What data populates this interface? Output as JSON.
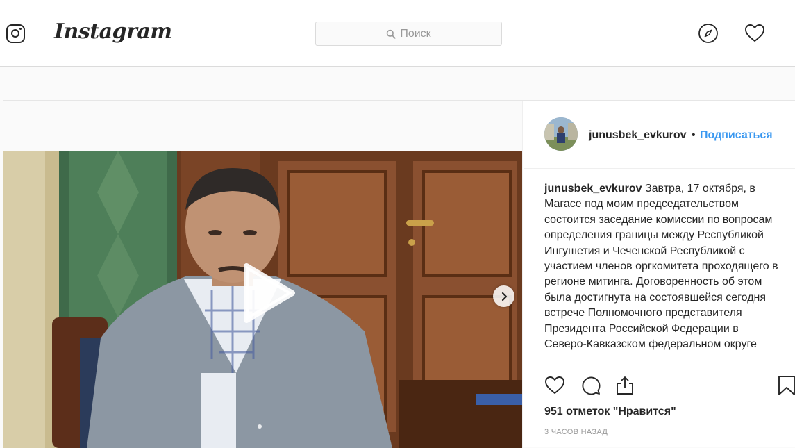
{
  "header": {
    "wordmark": "Instagram",
    "search_placeholder": "Поиск",
    "icons": [
      "instagram-glyph-icon",
      "search-icon",
      "compass-icon",
      "heart-icon"
    ]
  },
  "post": {
    "author": "junusbek_evkurov",
    "bullet": "•",
    "follow_label": "Подписаться",
    "caption_user": "junusbek_evkurov",
    "caption_text": "Завтра, 17 октября, в Магасе под моим председательством состоится заседание комиссии по вопросам определения границы между Республикой Ингушетия и Чеченской Республикой с участием членов оргкомитета проходящего в регионе митинга. Договоренность об этом была достигнута на состоявшейся сегодня встрече Полномочного представителя Президента Российской Федерации в Северо-Кавказском федеральном округе",
    "likes": "951 отметок \"Нравится\"",
    "time": "3 часов назад",
    "media_type": "video",
    "icons": [
      "play-icon",
      "next-arrow-icon",
      "like-icon",
      "comment-icon",
      "share-icon",
      "save-icon"
    ]
  },
  "colors": {
    "link": "#3897f0",
    "text": "#262626",
    "muted": "#999999",
    "border": "#dbdbdb"
  }
}
